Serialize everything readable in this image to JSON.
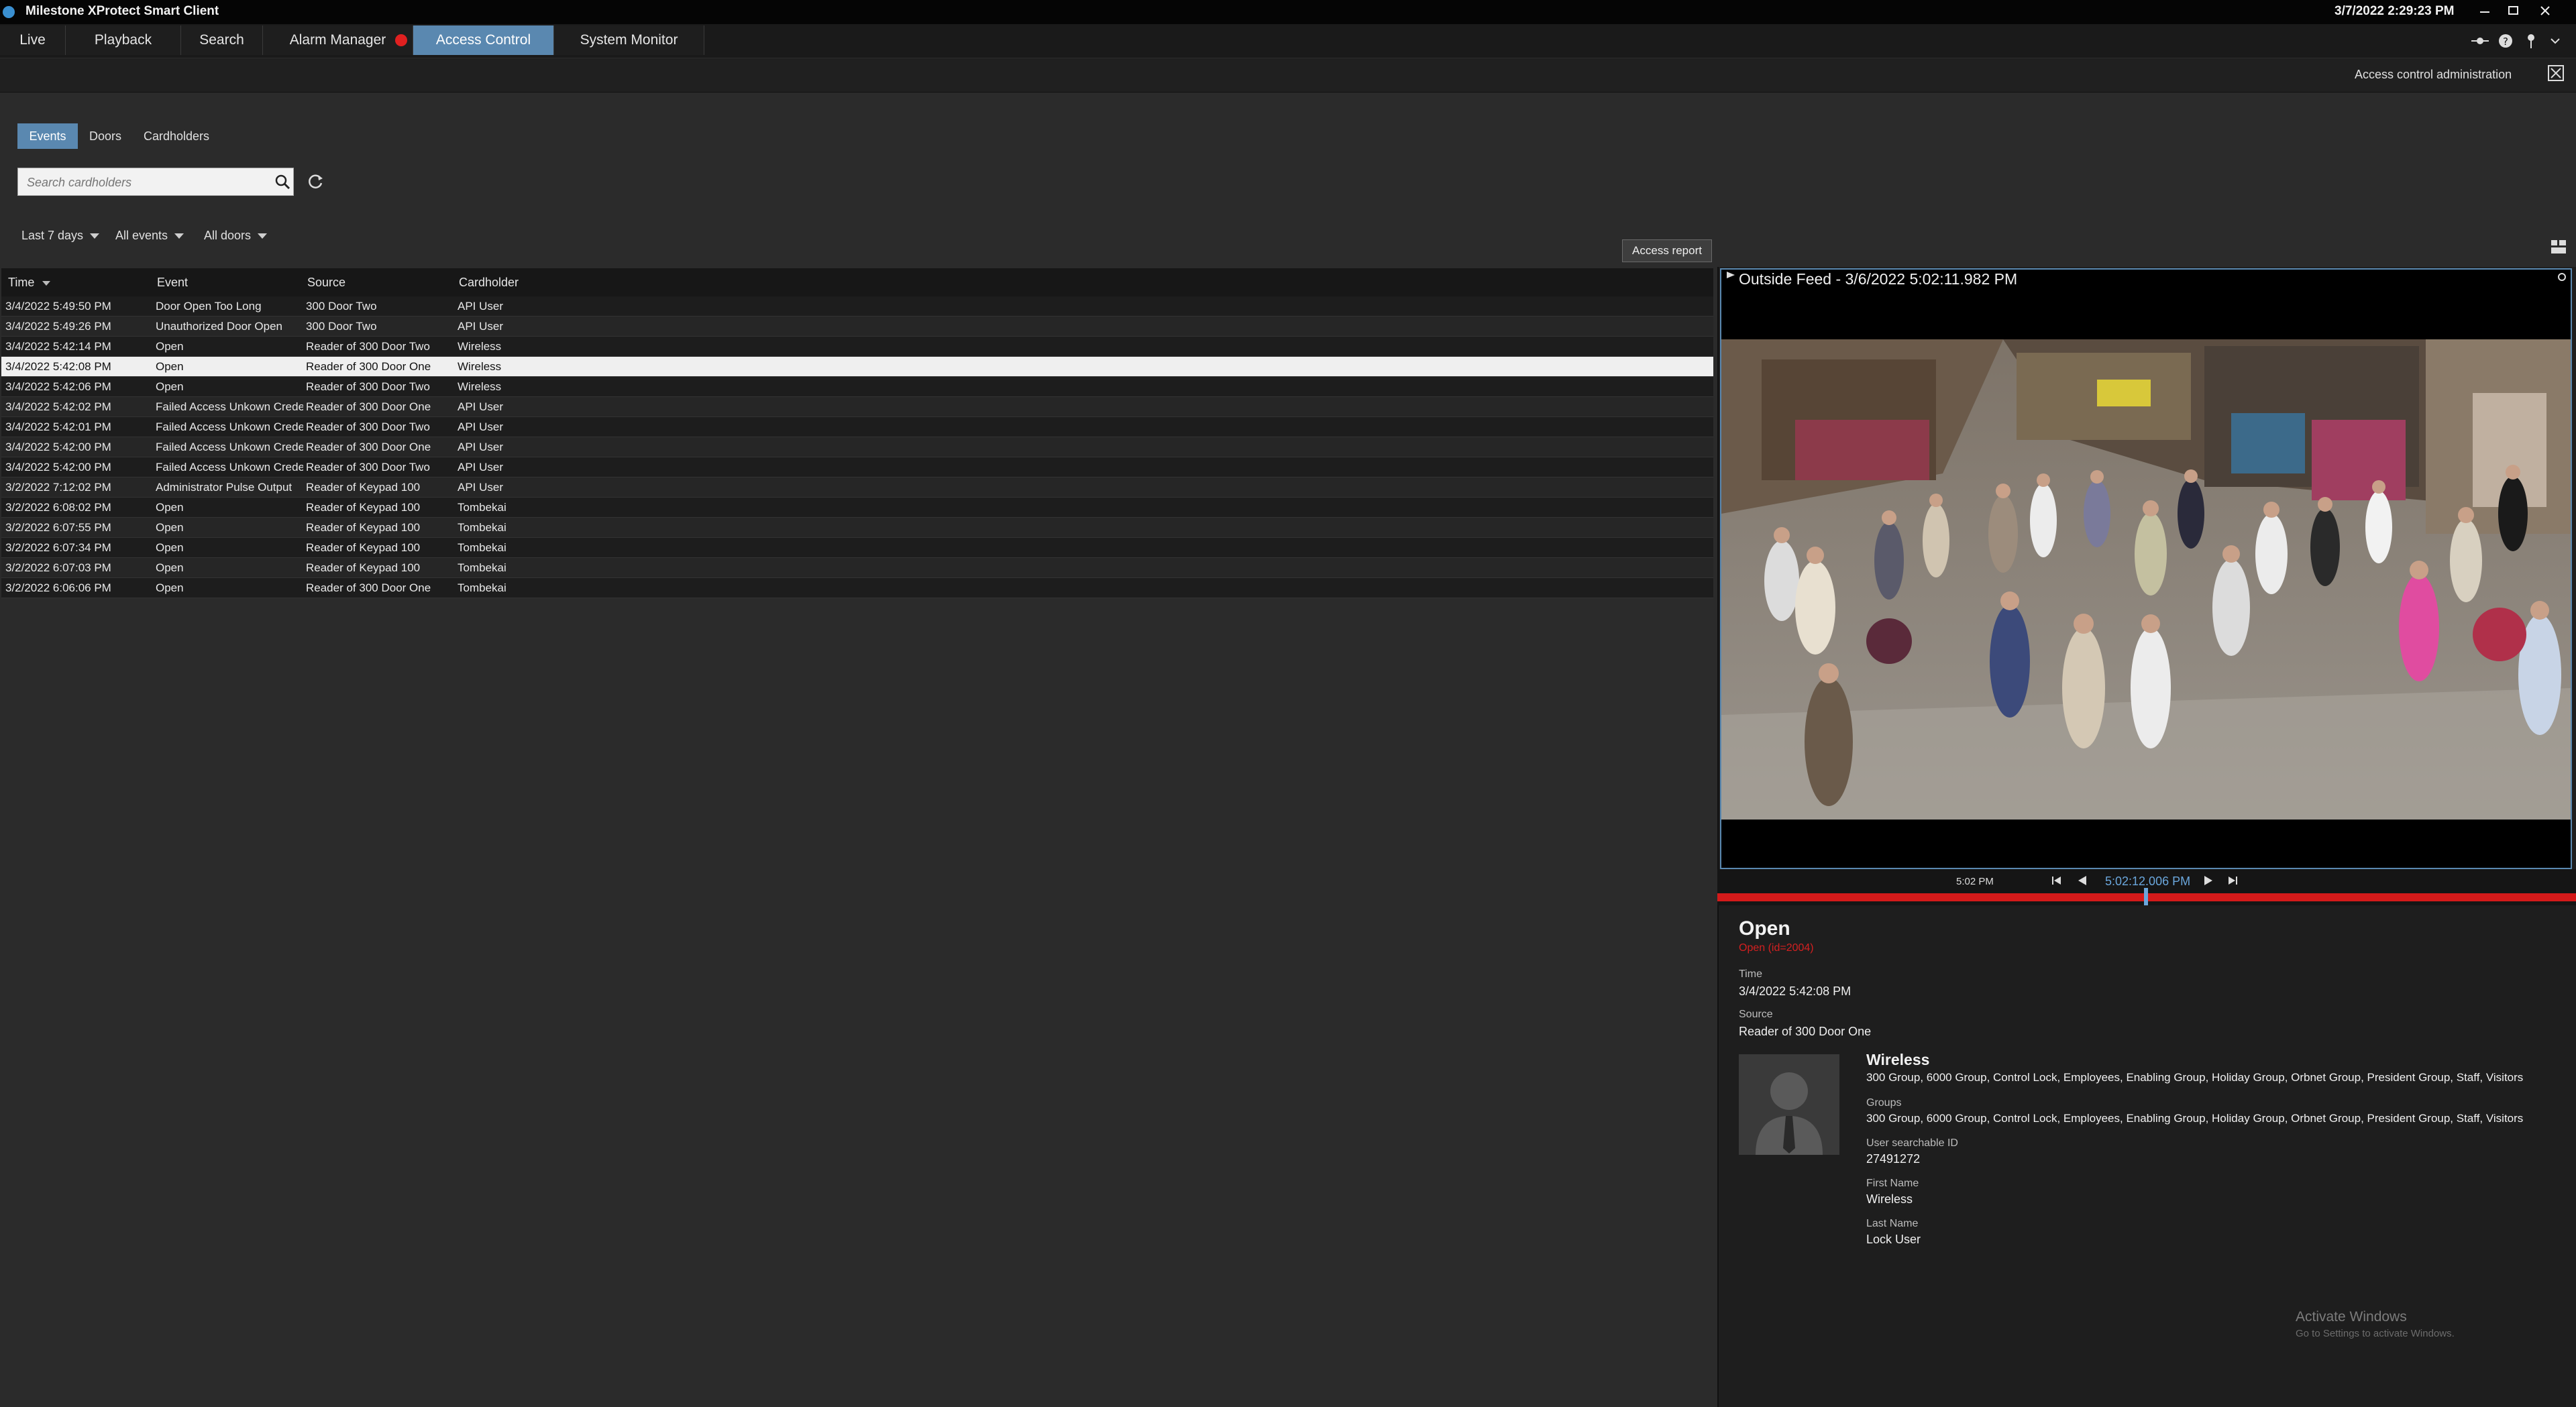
{
  "window": {
    "title": "Milestone XProtect Smart Client",
    "datetime": "3/7/2022 2:29:23 PM"
  },
  "tabs": [
    {
      "label": "Live"
    },
    {
      "label": "Playback"
    },
    {
      "label": "Search"
    },
    {
      "label": "Alarm Manager"
    },
    {
      "label": "Access Control",
      "active": true
    },
    {
      "label": "System Monitor"
    }
  ],
  "header": {
    "admin_link": "Access control administration"
  },
  "subtabs": [
    {
      "label": "Events",
      "active": true
    },
    {
      "label": "Doors"
    },
    {
      "label": "Cardholders"
    }
  ],
  "search": {
    "placeholder": "Search cardholders"
  },
  "filters": {
    "period": "Last 7 days",
    "events": "All events",
    "doors": "All doors"
  },
  "access_report_label": "Access report",
  "table": {
    "columns": [
      "Time",
      "Event",
      "Source",
      "Cardholder"
    ],
    "rows": [
      {
        "time": "3/4/2022 5:49:50 PM",
        "event": "Door Open Too Long",
        "source": "300 Door Two",
        "cardholder": "API User"
      },
      {
        "time": "3/4/2022 5:49:26 PM",
        "event": "Unauthorized Door Open",
        "source": "300 Door Two",
        "cardholder": "API User"
      },
      {
        "time": "3/4/2022 5:42:14 PM",
        "event": "Open",
        "source": "Reader of 300 Door Two",
        "cardholder": "Wireless"
      },
      {
        "time": "3/4/2022 5:42:08 PM",
        "event": "Open",
        "source": "Reader of 300 Door One",
        "cardholder": "Wireless",
        "selected": true
      },
      {
        "time": "3/4/2022 5:42:06 PM",
        "event": "Open",
        "source": "Reader of 300 Door Two",
        "cardholder": "Wireless"
      },
      {
        "time": "3/4/2022 5:42:02 PM",
        "event": "Failed Access Unkown Credential",
        "source": "Reader of 300 Door One",
        "cardholder": "API User"
      },
      {
        "time": "3/4/2022 5:42:01 PM",
        "event": "Failed Access Unkown Credential",
        "source": "Reader of 300 Door Two",
        "cardholder": "API User"
      },
      {
        "time": "3/4/2022 5:42:00 PM",
        "event": "Failed Access Unkown Credential",
        "source": "Reader of 300 Door One",
        "cardholder": "API User"
      },
      {
        "time": "3/4/2022 5:42:00 PM",
        "event": "Failed Access Unkown Credential",
        "source": "Reader of 300 Door Two",
        "cardholder": "API User"
      },
      {
        "time": "3/2/2022 7:12:02 PM",
        "event": "Administrator Pulse Output",
        "source": "Reader of Keypad 100",
        "cardholder": "API User"
      },
      {
        "time": "3/2/2022 6:08:02 PM",
        "event": "Open",
        "source": "Reader of Keypad 100",
        "cardholder": "Tombekai"
      },
      {
        "time": "3/2/2022 6:07:55 PM",
        "event": "Open",
        "source": "Reader of Keypad 100",
        "cardholder": "Tombekai"
      },
      {
        "time": "3/2/2022 6:07:34 PM",
        "event": "Open",
        "source": "Reader of Keypad 100",
        "cardholder": "Tombekai"
      },
      {
        "time": "3/2/2022 6:07:03 PM",
        "event": "Open",
        "source": "Reader of Keypad 100",
        "cardholder": "Tombekai"
      },
      {
        "time": "3/2/2022 6:06:06 PM",
        "event": "Open",
        "source": "Reader of 300 Door One",
        "cardholder": "Tombekai"
      }
    ]
  },
  "video": {
    "title": "Outside Feed - 3/6/2022 5:02:11.982 PM",
    "timeline_tick": "5:02 PM",
    "playback_time": "5:02:12.006 PM"
  },
  "details": {
    "event": "Open",
    "event_id": "Open (id=2004)",
    "time_label": "Time",
    "time_value": "3/4/2022 5:42:08 PM",
    "source_label": "Source",
    "source_value": "Reader of 300 Door One",
    "cardholder": {
      "name": "Wireless",
      "summary": "300 Group, 6000 Group, Control Lock, Employees, Enabling Group, Holiday Group, Orbnet Group, President Group, Staff, Visitors",
      "groups_label": "Groups",
      "groups_value": "300 Group, 6000 Group, Control Lock, Employees, Enabling Group, Holiday Group, Orbnet Group, President Group, Staff, Visitors",
      "user_id_label": "User searchable ID",
      "user_id_value": "27491272",
      "first_name_label": "First Name",
      "first_name_value": "Wireless",
      "last_name_label": "Last Name",
      "last_name_value": "Lock User"
    }
  },
  "watermark": {
    "title": "Activate Windows",
    "subtitle": "Go to Settings to activate Windows."
  },
  "colors": {
    "accent": "#5a88b0",
    "timeline": "#d41a1a",
    "event_id": "#d42020"
  }
}
